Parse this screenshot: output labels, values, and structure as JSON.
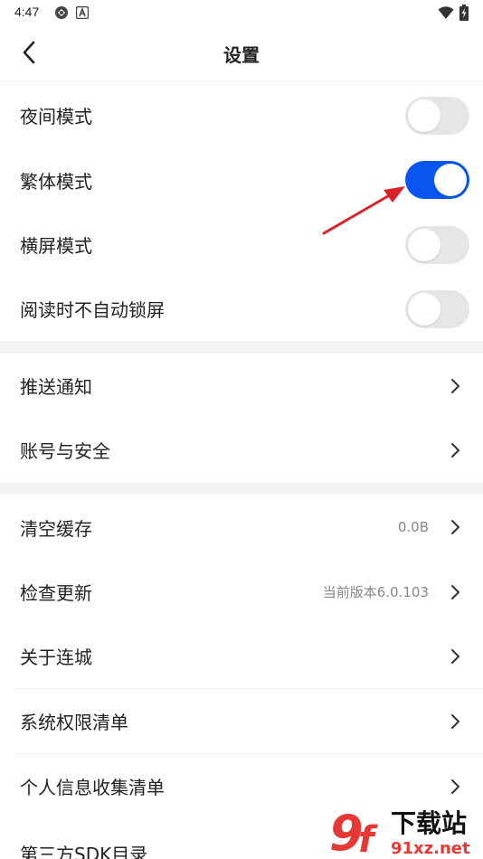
{
  "status_bar": {
    "time": "4:47",
    "icons": [
      "sync-icon",
      "a-badge-icon",
      "wifi-icon",
      "battery-charging-icon"
    ]
  },
  "header": {
    "title": "设置",
    "back_icon": "chevron-left-icon"
  },
  "toggles": [
    {
      "label": "夜间模式",
      "on": false
    },
    {
      "label": "繁体模式",
      "on": true
    },
    {
      "label": "横屏模式",
      "on": false
    },
    {
      "label": "阅读时不自动锁屏",
      "on": false
    }
  ],
  "group2": [
    {
      "label": "推送通知"
    },
    {
      "label": "账号与安全"
    }
  ],
  "group3": [
    {
      "label": "清空缓存",
      "value": "0.0B"
    },
    {
      "label": "检查更新",
      "value": "当前版本6.0.103"
    },
    {
      "label": "关于连城"
    },
    {
      "label": "系统权限清单"
    },
    {
      "label": "个人信息收集清单"
    },
    {
      "label": "第三方SDK目录"
    }
  ],
  "colors": {
    "toggle_on": "#0a55f0",
    "toggle_off": "#e6e6e6",
    "annotation_arrow": "#d9232a"
  },
  "watermark": {
    "mark": "9f",
    "text": "下载站",
    "site": "91xz.net"
  }
}
